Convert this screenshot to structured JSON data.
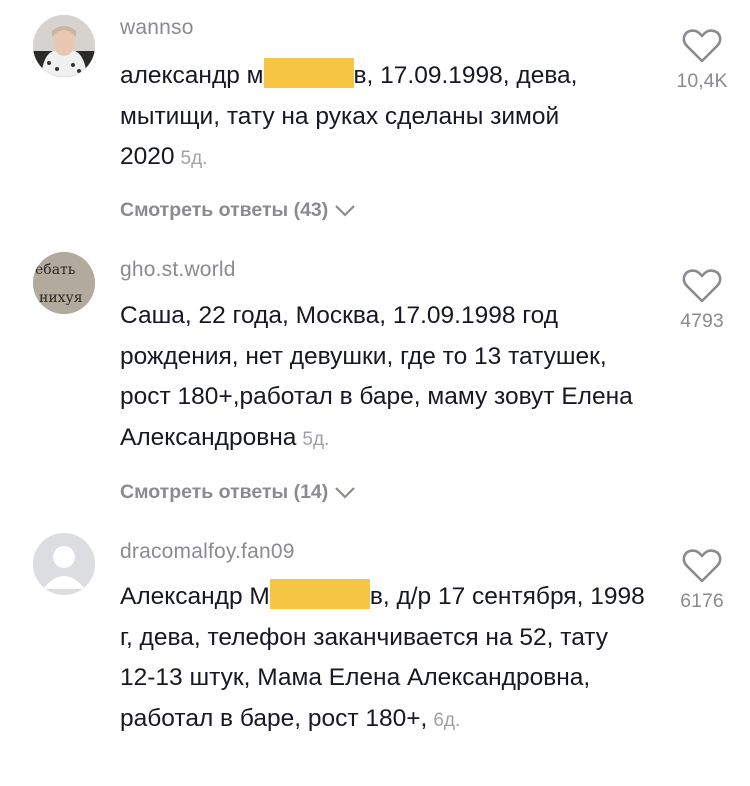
{
  "comments": [
    {
      "username": "wannso",
      "text_before": "александр м",
      "text_after": "в, 17.09.1998, дева, мытищи, тату на руках сделаны зимой 2020",
      "time": "5д.",
      "replies": "Смотреть ответы (43)",
      "likes": "10,4K"
    },
    {
      "username": "gho.st.world",
      "avatar_text": [
        "ебать",
        "нихуя"
      ],
      "text": "Саша, 22 года, Москва, 17.09.1998 год рождения, нет девушки, где то 13 татушек, рост 180+,работал в баре, маму зовут Елена Александровна",
      "time": "5д.",
      "replies": "Смотреть ответы (14)",
      "likes": "4793"
    },
    {
      "username": "dracomalfoy.fan09",
      "text_before": "Александр М",
      "text_after": "в, д/р 17 сентября, 1998 г, дева, телефон заканчивается на 52, тату 12-13 штук, Мама Елена Александровна, работал в баре, рост 180+,",
      "time": "6д.",
      "likes": "6176"
    }
  ],
  "icons": {
    "like": "heart-outline-icon",
    "expand": "chevron-down-icon"
  },
  "colors": {
    "redaction": "#f6c544",
    "muted": "#8a8b91",
    "text": "#161823"
  }
}
